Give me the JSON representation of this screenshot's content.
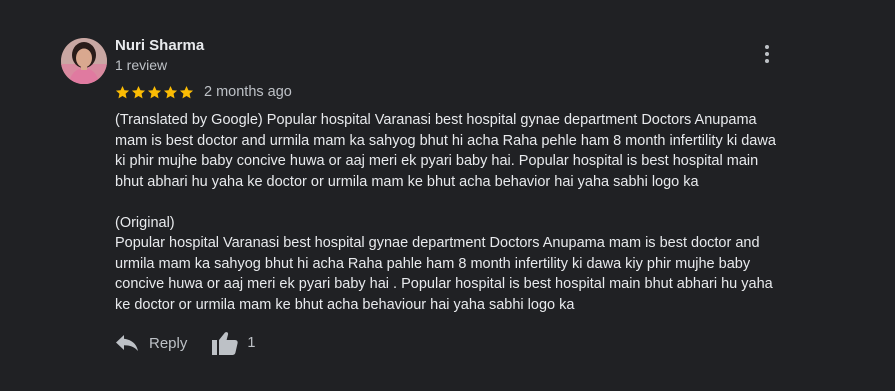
{
  "review": {
    "author": {
      "name": "Nuri Sharma",
      "review_count": "1 review",
      "avatar_icon": "profile-photo"
    },
    "menu_icon": "more-vert-icon",
    "rating": 5,
    "rating_max": 5,
    "star_color": "#fbbc04",
    "date": "2 months ago",
    "translated_lines": [
      "(Translated by Google) Popular hospital Varanasi best hospital gynae department Doctors Anupama",
      "mam is best doctor and urmila mam ka sahyog bhut hi acha Raha pehle ham 8 month infertility ki dawa",
      "ki phir mujhe baby concive huwa or aaj meri ek pyari baby hai. Popular hospital is best hospital main",
      "bhut abhari hu yaha ke doctor or urmila mam ke bhut acha behavior hai yaha sabhi logo ka"
    ],
    "original_label": "(Original)",
    "original_lines": [
      "Popular hospital Varanasi best hospital gynae department Doctors Anupama mam is best doctor and",
      "urmila mam ka sahyog bhut hi acha Raha pahle ham 8 month infertility ki dawa kiy phir mujhe baby",
      "concive huwa or aaj meri ek pyari baby hai . Popular hospital is best hospital main bhut abhari hu yaha",
      "ke doctor or urmila mam ke bhut acha behaviour hai yaha sabhi logo ka"
    ],
    "actions": {
      "reply_label": "Reply",
      "reply_icon": "reply-icon",
      "like_icon": "thumbs-up-icon",
      "like_count": "1"
    }
  }
}
